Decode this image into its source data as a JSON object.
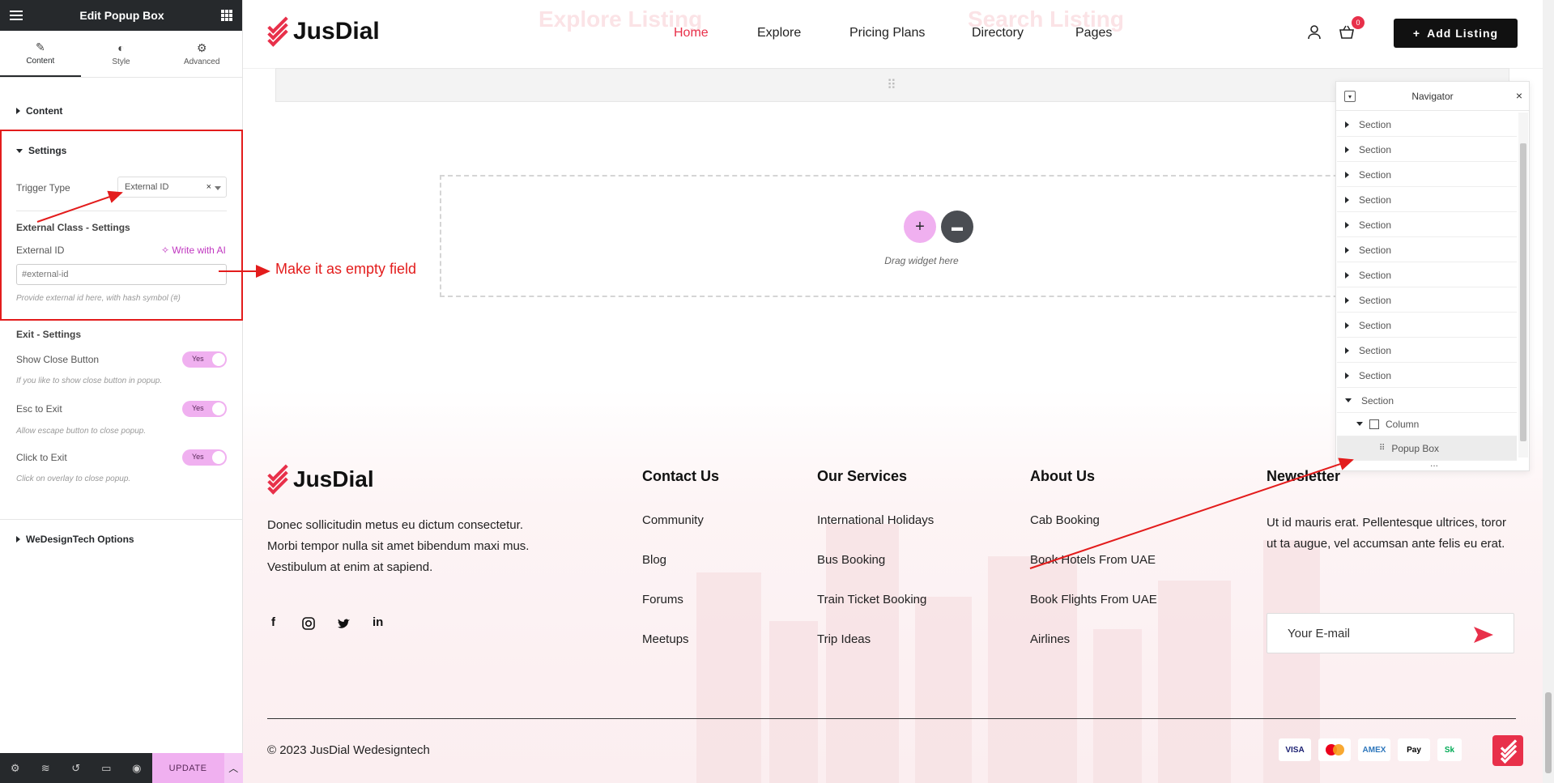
{
  "editor": {
    "title": "Edit Popup Box",
    "tabs": [
      {
        "label": "Content",
        "icon": "pencil-icon"
      },
      {
        "label": "Style",
        "icon": "half-circle-icon"
      },
      {
        "label": "Advanced",
        "icon": "gear-icon"
      }
    ],
    "sections": {
      "content": "Content",
      "settings": "Settings",
      "wedesigntech": "WeDesignTech Options"
    },
    "trigger_type": {
      "label": "Trigger Type",
      "value": "External ID"
    },
    "external_class_heading": "External Class - Settings",
    "external_id": {
      "label": "External ID",
      "write_ai": "Write with AI",
      "placeholder": "#external-id",
      "hint": "Provide external id here, with hash symbol (#)"
    },
    "exit_heading": "Exit - Settings",
    "toggles": [
      {
        "label": "Show Close Button",
        "value": "Yes",
        "hint": "If you like to show close button in popup."
      },
      {
        "label": "Esc to Exit",
        "value": "Yes",
        "hint": "Allow escape button to close popup."
      },
      {
        "label": "Click to Exit",
        "value": "Yes",
        "hint": "Click on overlay to close popup."
      }
    ],
    "footer": {
      "update_label": "UPDATE"
    }
  },
  "annotation": {
    "text": "Make it as empty field",
    "color": "#e31c1c"
  },
  "site": {
    "brand": "JusDial",
    "brand_color": "#e8304a",
    "nav": [
      "Home",
      "Explore",
      "Pricing Plans",
      "Directory",
      "Pages"
    ],
    "active_nav": "Home",
    "watermarks": [
      "Explore Listing",
      "Search Listing"
    ],
    "cart_count": "0",
    "add_listing": "Add Listing",
    "dropzone_text": "Drag widget here",
    "footer": {
      "about": "Donec sollicitudin metus eu dictum consectetur. Morbi tempor nulla sit amet bibendum maxi mus. Vestibulum at enim at sapiend.",
      "contact": {
        "title": "Contact Us",
        "links": [
          "Community",
          "Blog",
          "Forums",
          "Meetups"
        ]
      },
      "services": {
        "title": "Our Services",
        "links": [
          "International Holidays",
          "Bus Booking",
          "Train Ticket Booking",
          "Trip Ideas"
        ]
      },
      "about_us": {
        "title": "About Us",
        "links": [
          "Cab Booking",
          "Book Hotels From UAE",
          "Book Flights From UAE",
          "Airlines"
        ]
      },
      "newsletter": {
        "title": "Newsletter",
        "text": "Ut id mauris erat. Pellentesque ultrices, toror ut ta augue, vel accumsan ante felis eu erat.",
        "placeholder": "Your E-mail"
      },
      "copyright": "© 2023 JusDial Wedesigntech",
      "payments": [
        "VISA",
        "MC",
        "AMEX",
        "Pay",
        "Sk"
      ]
    }
  },
  "navigator": {
    "title": "Navigator",
    "rows": [
      "Section",
      "Section",
      "Section",
      "Section",
      "Section",
      "Section",
      "Section",
      "Section",
      "Section",
      "Section",
      "Section",
      "Section"
    ],
    "column_label": "Column",
    "popup_label": "Popup Box",
    "more": "..."
  }
}
